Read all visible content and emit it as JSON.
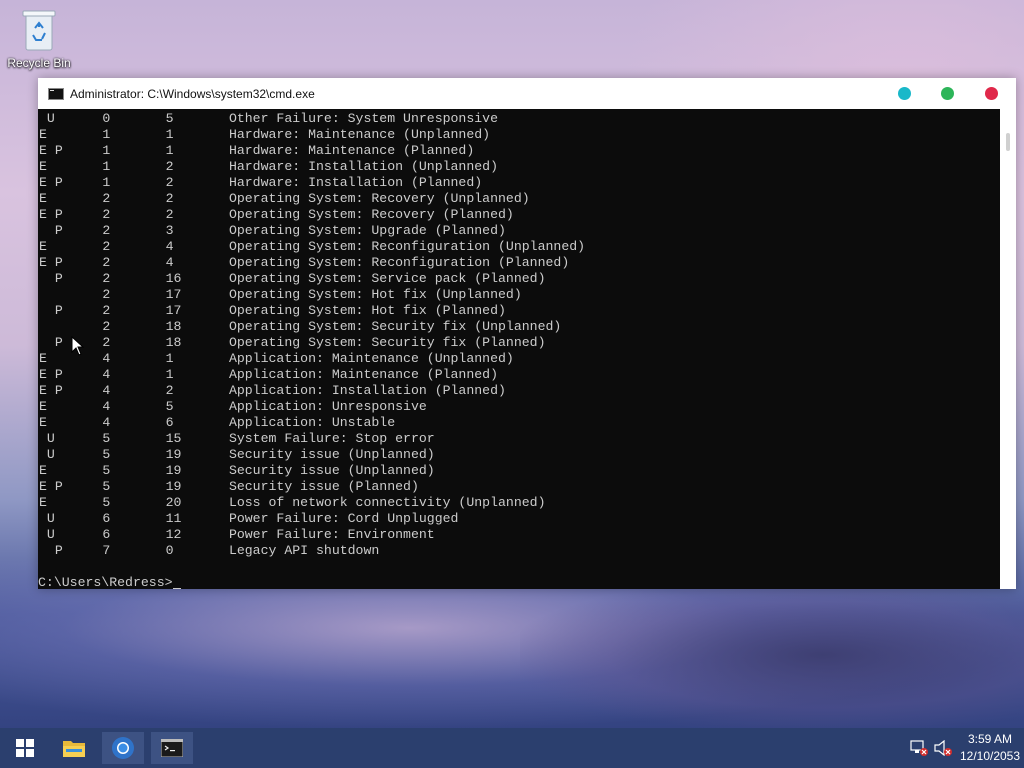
{
  "desktop": {
    "icons": [
      {
        "label": "Recycle Bin",
        "icon": "recycle-bin-icon"
      }
    ]
  },
  "window": {
    "title": "Administrator: C:\\Windows\\system32\\cmd.exe",
    "controls": {
      "minimize_color": "#19b8c9",
      "maximize_color": "#2db559",
      "close_color": "#e0284a"
    }
  },
  "console": {
    "rows": [
      {
        "flags": " U",
        "major": "0",
        "minor": "5",
        "description": "Other Failure: System Unresponsive"
      },
      {
        "flags": "E",
        "major": "1",
        "minor": "1",
        "description": "Hardware: Maintenance (Unplanned)"
      },
      {
        "flags": "E P",
        "major": "1",
        "minor": "1",
        "description": "Hardware: Maintenance (Planned)"
      },
      {
        "flags": "E",
        "major": "1",
        "minor": "2",
        "description": "Hardware: Installation (Unplanned)"
      },
      {
        "flags": "E P",
        "major": "1",
        "minor": "2",
        "description": "Hardware: Installation (Planned)"
      },
      {
        "flags": "E",
        "major": "2",
        "minor": "2",
        "description": "Operating System: Recovery (Unplanned)"
      },
      {
        "flags": "E P",
        "major": "2",
        "minor": "2",
        "description": "Operating System: Recovery (Planned)"
      },
      {
        "flags": "  P",
        "major": "2",
        "minor": "3",
        "description": "Operating System: Upgrade (Planned)"
      },
      {
        "flags": "E",
        "major": "2",
        "minor": "4",
        "description": "Operating System: Reconfiguration (Unplanned)"
      },
      {
        "flags": "E P",
        "major": "2",
        "minor": "4",
        "description": "Operating System: Reconfiguration (Planned)"
      },
      {
        "flags": "  P",
        "major": "2",
        "minor": "16",
        "description": "Operating System: Service pack (Planned)"
      },
      {
        "flags": "",
        "major": "2",
        "minor": "17",
        "description": "Operating System: Hot fix (Unplanned)"
      },
      {
        "flags": "  P",
        "major": "2",
        "minor": "17",
        "description": "Operating System: Hot fix (Planned)"
      },
      {
        "flags": "",
        "major": "2",
        "minor": "18",
        "description": "Operating System: Security fix (Unplanned)"
      },
      {
        "flags": "  P",
        "major": "2",
        "minor": "18",
        "description": "Operating System: Security fix (Planned)"
      },
      {
        "flags": "E",
        "major": "4",
        "minor": "1",
        "description": "Application: Maintenance (Unplanned)"
      },
      {
        "flags": "E P",
        "major": "4",
        "minor": "1",
        "description": "Application: Maintenance (Planned)"
      },
      {
        "flags": "E P",
        "major": "4",
        "minor": "2",
        "description": "Application: Installation (Planned)"
      },
      {
        "flags": "E",
        "major": "4",
        "minor": "5",
        "description": "Application: Unresponsive"
      },
      {
        "flags": "E",
        "major": "4",
        "minor": "6",
        "description": "Application: Unstable"
      },
      {
        "flags": " U",
        "major": "5",
        "minor": "15",
        "description": "System Failure: Stop error"
      },
      {
        "flags": " U",
        "major": "5",
        "minor": "19",
        "description": "Security issue (Unplanned)"
      },
      {
        "flags": "E",
        "major": "5",
        "minor": "19",
        "description": "Security issue (Unplanned)"
      },
      {
        "flags": "E P",
        "major": "5",
        "minor": "19",
        "description": "Security issue (Planned)"
      },
      {
        "flags": "E",
        "major": "5",
        "minor": "20",
        "description": "Loss of network connectivity (Unplanned)"
      },
      {
        "flags": " U",
        "major": "6",
        "minor": "11",
        "description": "Power Failure: Cord Unplugged"
      },
      {
        "flags": " U",
        "major": "6",
        "minor": "12",
        "description": "Power Failure: Environment"
      },
      {
        "flags": "  P",
        "major": "7",
        "minor": "0",
        "description": "Legacy API shutdown"
      }
    ],
    "prompt": "C:\\Users\\Redress>"
  },
  "taskbar": {
    "items": [
      {
        "name": "start",
        "icon": "windows-start-icon"
      },
      {
        "name": "file-explorer",
        "icon": "folder-icon"
      },
      {
        "name": "chrome",
        "icon": "chrome-icon"
      },
      {
        "name": "command-prompt",
        "icon": "cmd-icon"
      }
    ],
    "tray": {
      "network_icon": "network-disconnected-icon",
      "volume_icon": "volume-muted-icon"
    },
    "clock": {
      "time": "3:59 AM",
      "date": "12/10/2053"
    }
  }
}
